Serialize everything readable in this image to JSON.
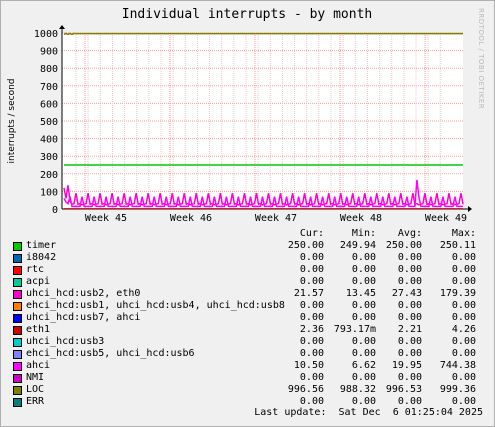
{
  "chart_data": {
    "type": "line",
    "title": "Individual interrupts - by month",
    "ylabel": "interrupts / second",
    "xlabel": "",
    "ylim": [
      0,
      1000
    ],
    "yticks": [
      0,
      100,
      200,
      300,
      400,
      500,
      600,
      700,
      800,
      900,
      1000
    ],
    "xticks": [
      "Week 45",
      "Week 46",
      "Week 47",
      "Week 48",
      "Week 49"
    ],
    "grid": true,
    "legend_placement": "bottom",
    "columns": [
      "Cur:",
      "Min:",
      "Avg:",
      "Max:"
    ],
    "series": [
      {
        "name": "timer",
        "color": "#00cc00",
        "cur": "250.00",
        "min": "249.94",
        "avg": "250.00",
        "max": "250.11"
      },
      {
        "name": "i8042",
        "color": "#0066b3",
        "cur": "0.00",
        "min": "0.00",
        "avg": "0.00",
        "max": "0.00"
      },
      {
        "name": "rtc",
        "color": "#ff8000",
        "cur": "0.00",
        "min": "0.00",
        "avg": "0.00",
        "max": "0.00"
      },
      {
        "name": "acpi",
        "color": "#ffcc00",
        "cur": "0.00",
        "min": "0.00",
        "avg": "0.00",
        "max": "0.00"
      },
      {
        "name": "uhci_hcd:usb2, eth0",
        "color": "#330099",
        "cur": "21.57",
        "min": "13.45",
        "avg": "27.43",
        "max": "179.39"
      },
      {
        "name": "ehci_hcd:usb1, uhci_hcd:usb4, uhci_hcd:usb8",
        "color": "#990099",
        "cur": "0.00",
        "min": "0.00",
        "avg": "0.00",
        "max": "0.00"
      },
      {
        "name": "uhci_hcd:usb7, ahci",
        "color": "#ccff00",
        "cur": "0.00",
        "min": "0.00",
        "avg": "0.00",
        "max": "0.00"
      },
      {
        "name": "eth1",
        "color": "#ff0000",
        "cur": "2.36",
        "min": "793.17m",
        "avg": "2.21",
        "max": "4.26"
      },
      {
        "name": "uhci_hcd:usb3",
        "color": "#808080",
        "cur": "0.00",
        "min": "0.00",
        "avg": "0.00",
        "max": "0.00"
      },
      {
        "name": "ehci_hcd:usb5, uhci_hcd:usb6",
        "color": "#008f00",
        "cur": "0.00",
        "min": "0.00",
        "avg": "0.00",
        "max": "0.00"
      },
      {
        "name": "ahci",
        "color": "#00487d",
        "cur": "10.50",
        "min": "6.62",
        "avg": "19.95",
        "max": "744.38"
      },
      {
        "name": "NMI",
        "color": "#b35a00",
        "cur": "0.00",
        "min": "0.00",
        "avg": "0.00",
        "max": "0.00"
      },
      {
        "name": "LOC",
        "color": "#b38f00",
        "cur": "996.56",
        "min": "988.32",
        "avg": "996.53",
        "max": "999.36"
      },
      {
        "name": "ERR",
        "color": "#6b006b",
        "cur": "0.00",
        "min": "0.00",
        "avg": "0.00",
        "max": "0.00"
      }
    ],
    "swatch_colors": [
      "#00cc00",
      "#0066b3",
      "#ff0000",
      "#00cc99",
      "#ff00cc",
      "#ff8000",
      "#0000ff",
      "#cc0000",
      "#00cccc",
      "#8080ff",
      "#ff00ff",
      "#cc00cc",
      "#808000",
      "#008080"
    ]
  },
  "last_update": "Last update:  Sat Dec  6 01:25:04 2025",
  "watermark": "RRDTOOL / TOBI OETIKER"
}
